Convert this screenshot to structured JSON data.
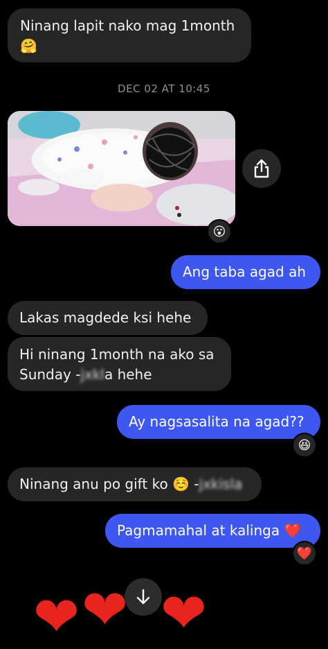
{
  "messages": [
    {
      "text": "Ninang lapit nako mag 1month",
      "emoji": "🤗"
    },
    {
      "text": "Ang taba agad ah"
    },
    {
      "text": "Lakas magdede ksi hehe"
    },
    {
      "line1": "Hi ninang 1month na ako sa",
      "line2_pre": "Sunday -",
      "line2_redacted": "jxkl",
      "line2_post": "a hehe"
    },
    {
      "text": "Ay nagsasalita na agad??"
    },
    {
      "pre": "Ninang anu po gift ko ☺️ -",
      "redacted": "jxkisla"
    },
    {
      "text": "Pagmamahal at kalinga",
      "emoji": "❤️"
    }
  ],
  "timestamp": "DEC 02 AT 10:45",
  "reactions": {
    "photo": "😮",
    "question": "😆",
    "love": "❤️"
  },
  "icons": {
    "share": "share-icon",
    "scroll": "arrow-down-icon"
  },
  "colors": {
    "outgoing": "#3d57f0",
    "incoming": "#262626",
    "background": "#000000"
  }
}
